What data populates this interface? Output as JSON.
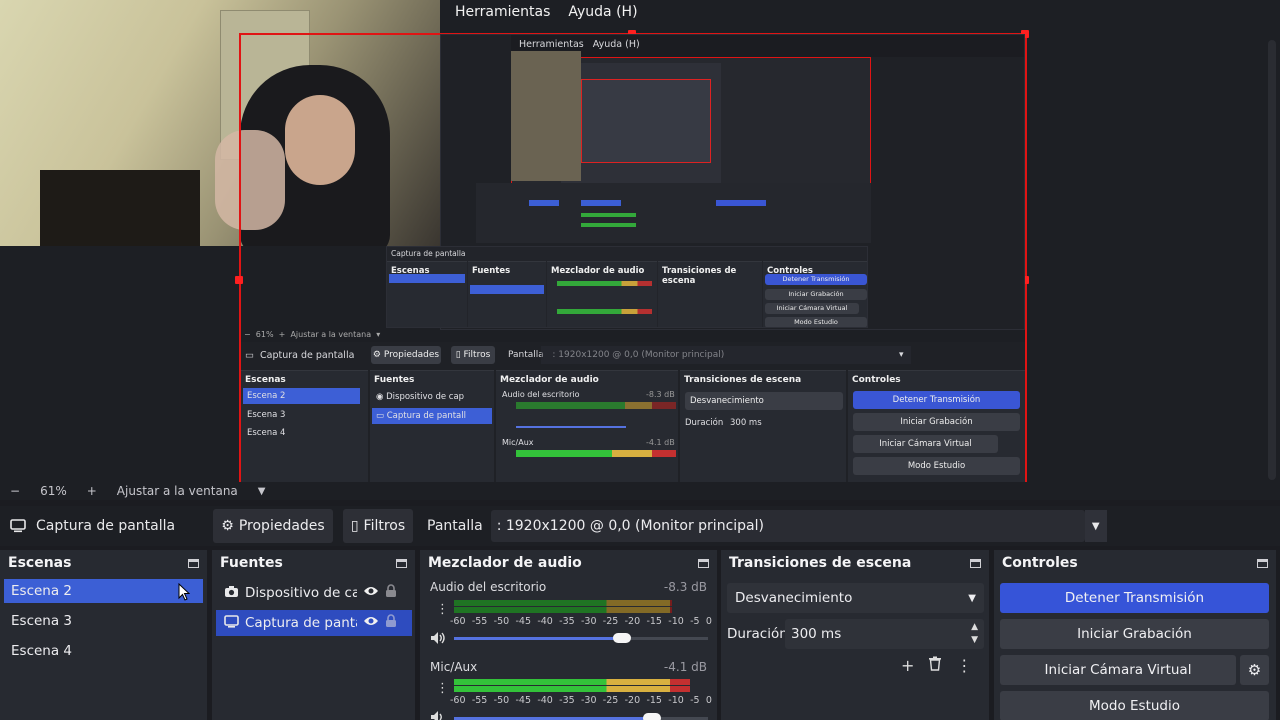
{
  "menu": {
    "tools": "Herramientas",
    "help": "Ayuda (H)"
  },
  "zoom": {
    "minus": "−",
    "value": "61%",
    "plus": "+",
    "fit": "Ajustar a la ventana"
  },
  "toolbar": {
    "source_name": "Captura de pantalla",
    "properties": "Propiedades",
    "filters": "Filtros",
    "screen_label": "Pantalla",
    "screen_value": ": 1920x1200 @ 0,0 (Monitor principal)"
  },
  "scenes": {
    "title": "Escenas",
    "items": [
      "Escena 2",
      "Escena 3",
      "Escena 4"
    ]
  },
  "sources": {
    "title": "Fuentes",
    "items": [
      "Dispositivo de cap",
      "Captura de pantall"
    ]
  },
  "mixer": {
    "title": "Mezclador de audio",
    "channels": [
      {
        "name": "Audio del escritorio",
        "db": "-8.3 dB",
        "level": 0.86,
        "volume": 0.66
      },
      {
        "name": "Mic/Aux",
        "db": "-4.1 dB",
        "level": 0.93,
        "volume": 0.78
      }
    ],
    "ticks": [
      "-60",
      "-55",
      "-50",
      "-45",
      "-40",
      "-35",
      "-30",
      "-25",
      "-20",
      "-15",
      "-10",
      "-5",
      "0"
    ]
  },
  "transitions": {
    "title": "Transiciones de escena",
    "type": "Desvanecimiento",
    "duration_label": "Duración",
    "duration_value": "300 ms"
  },
  "controls": {
    "title": "Controles",
    "stop_stream": "Detener Transmisión",
    "start_record": "Iniciar Grabación",
    "start_virtual_cam": "Iniciar Cámara Virtual",
    "studio_mode": "Modo Estudio"
  },
  "nested_preview": {
    "zoom_value": "61%",
    "zoom_fit": "Ajustar a la ventana",
    "source_name": "Captura de pantalla",
    "properties": "Propiedades",
    "filters": "Filtros",
    "screen_label": "Pantalla",
    "screen_value": ": 1920x1200 @ 0,0 (Monitor principal)",
    "scenes_title": "Escenas",
    "scenes": [
      "Escena 2",
      "Escena 3",
      "Escena 4"
    ],
    "sources_title": "Fuentes",
    "sources": [
      "Dispositivo de cap",
      "Captura de pantall"
    ],
    "mixer_title": "Mezclador de audio",
    "ch1_name": "Audio del escritorio",
    "ch1_db": "-8.3 dB",
    "ch2_name": "Mic/Aux",
    "ch2_db": "-4.1 dB",
    "trans_title": "Transiciones de escena",
    "trans_type": "Desvanecimiento",
    "duration_label": "Duración",
    "duration_value": "300 ms",
    "controls_title": "Controles",
    "stop_stream": "Detener Transmisión",
    "start_record": "Iniciar Grabación",
    "start_virtual_cam": "Iniciar Cámara Virtual",
    "studio_mode": "Modo Estudio",
    "menu_tools": "Herramientas",
    "menu_help": "Ayuda (H)"
  },
  "colors": {
    "accent_blue": "#3c5fd5",
    "record_red": "#e01414",
    "meter_green": "#33c23a",
    "meter_yellow": "#d8b040",
    "meter_red": "#c43030"
  }
}
